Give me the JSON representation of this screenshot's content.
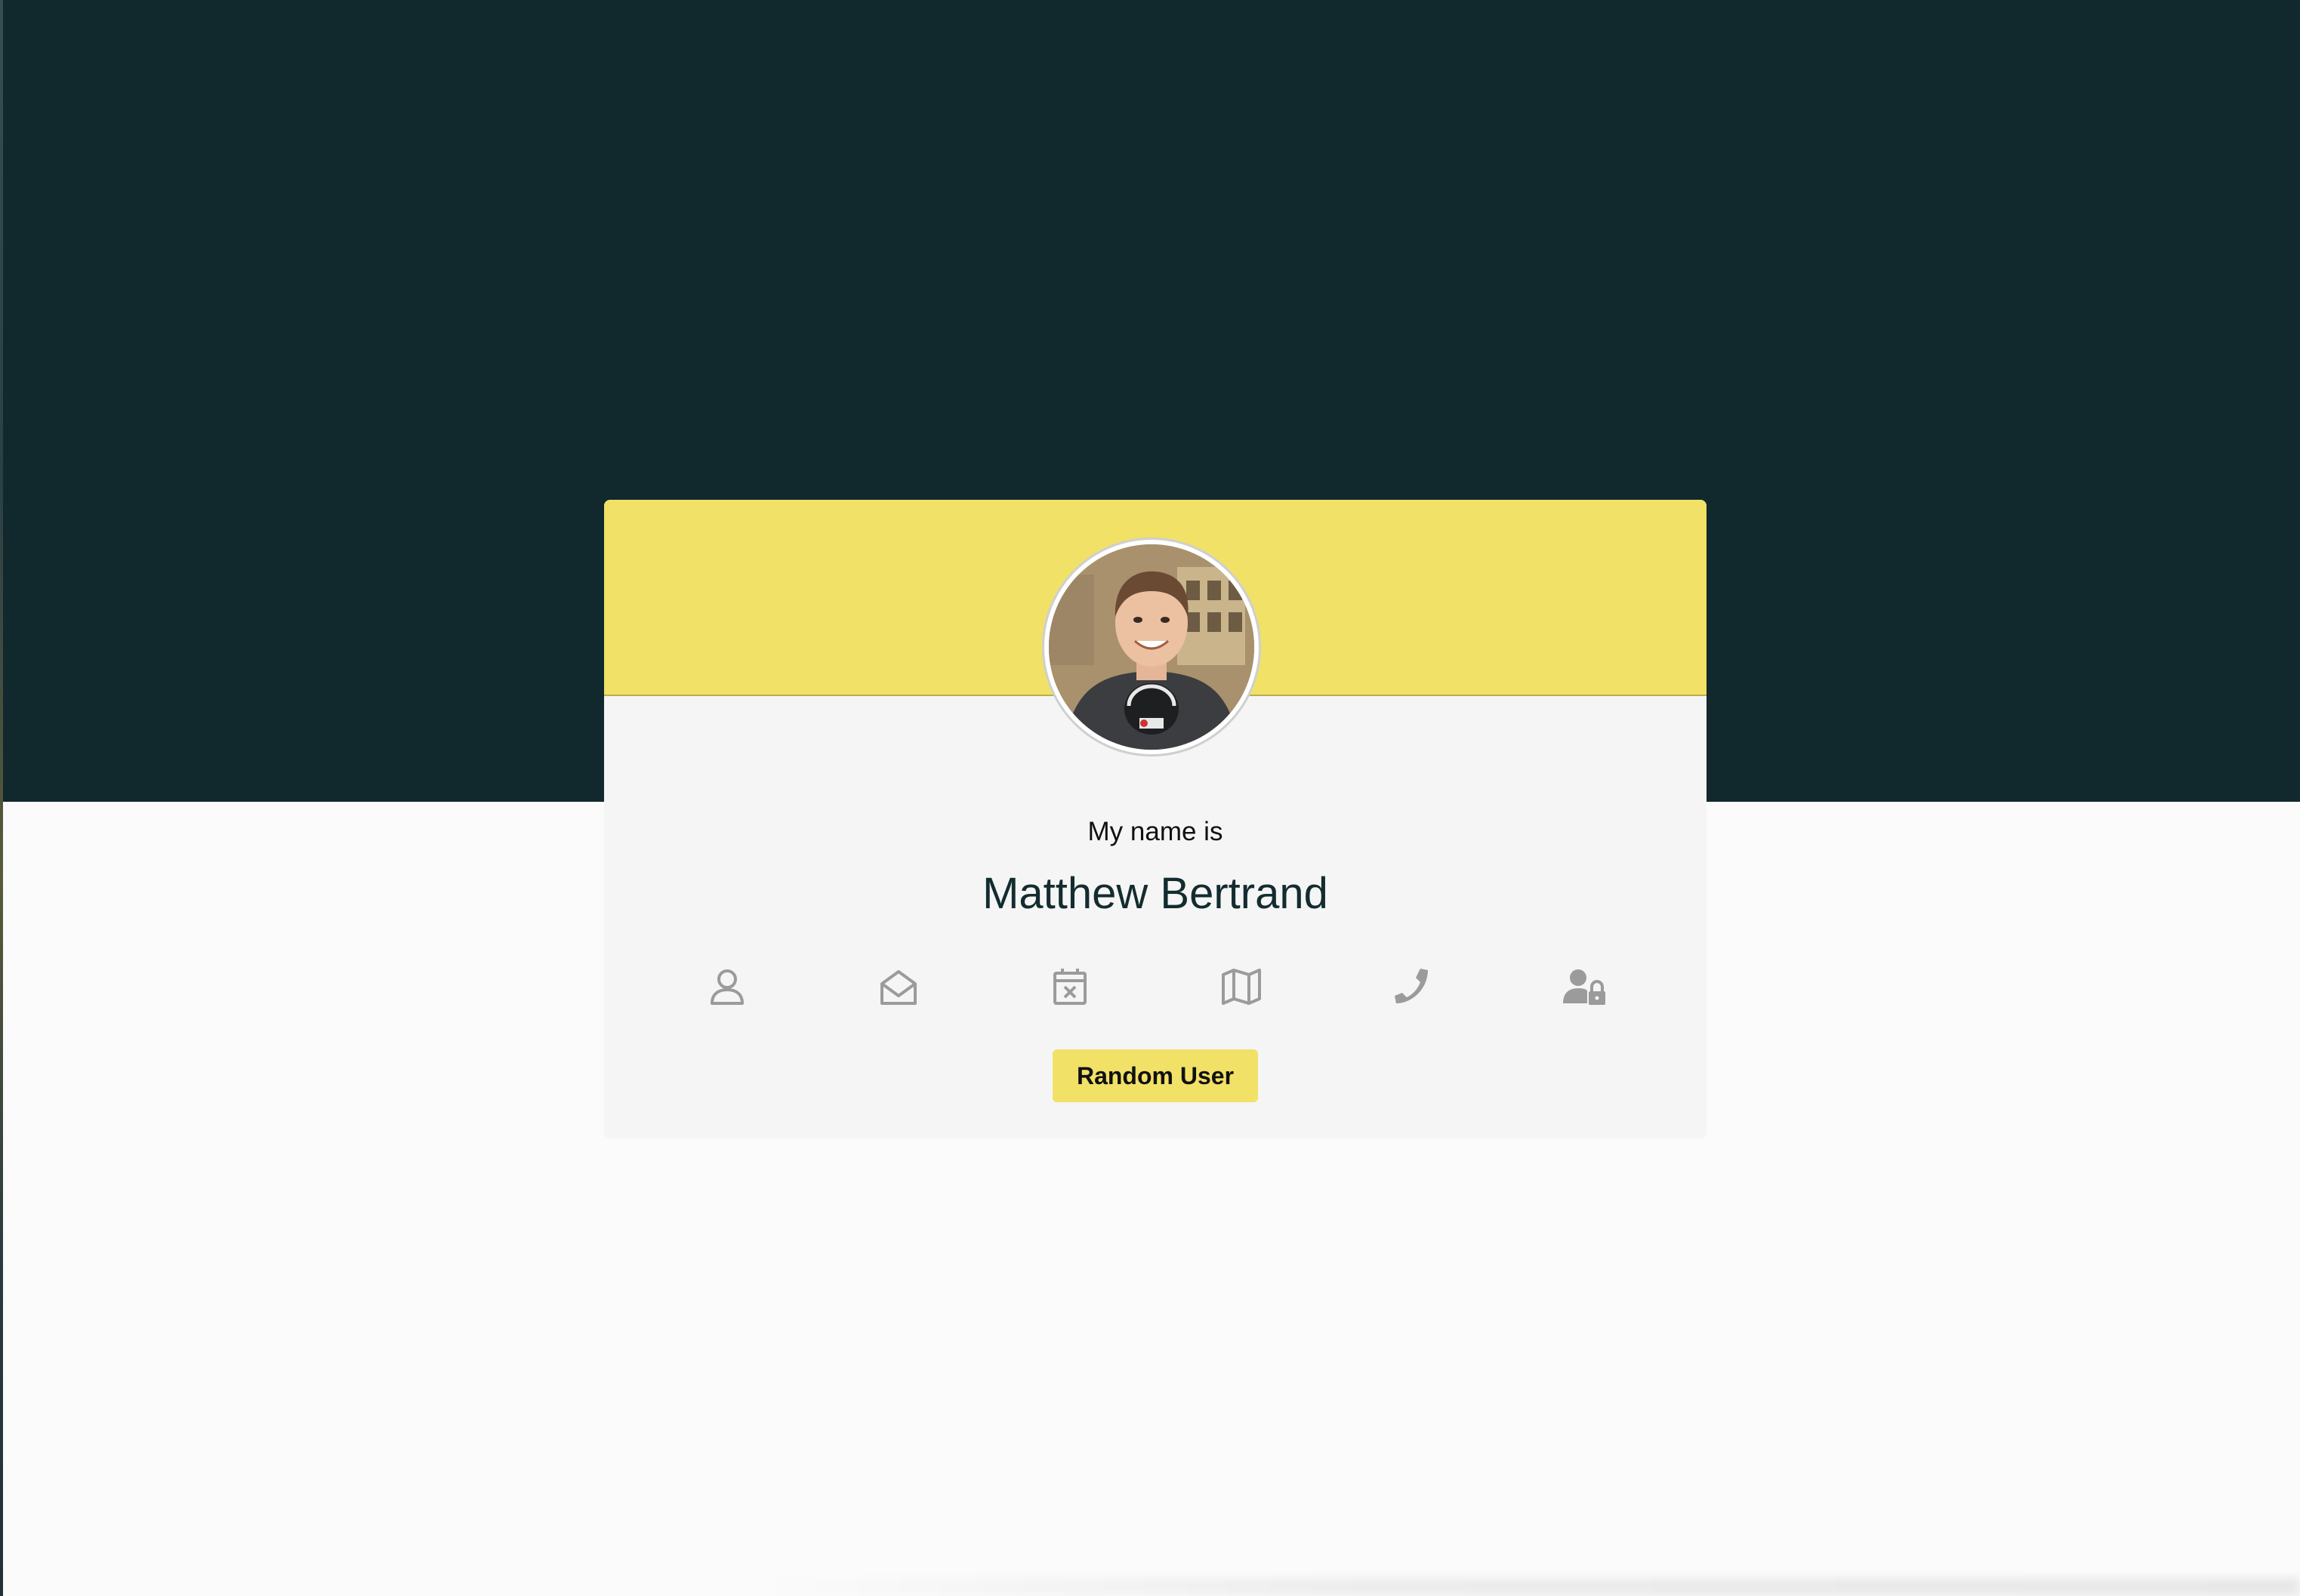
{
  "card": {
    "intro_label": "My name is",
    "value": "Matthew Bertrand",
    "avatar_alt": "user portrait",
    "button_label": "Random User"
  },
  "icons": [
    {
      "name": "user-icon"
    },
    {
      "name": "envelope-open-icon"
    },
    {
      "name": "calendar-icon"
    },
    {
      "name": "map-icon"
    },
    {
      "name": "phone-icon"
    },
    {
      "name": "user-lock-icon"
    }
  ],
  "colors": {
    "background_dark": "#11292c",
    "accent_yellow": "#f1e167",
    "card_body": "#f5f5f5",
    "icon_gray": "#9b9b9b"
  }
}
